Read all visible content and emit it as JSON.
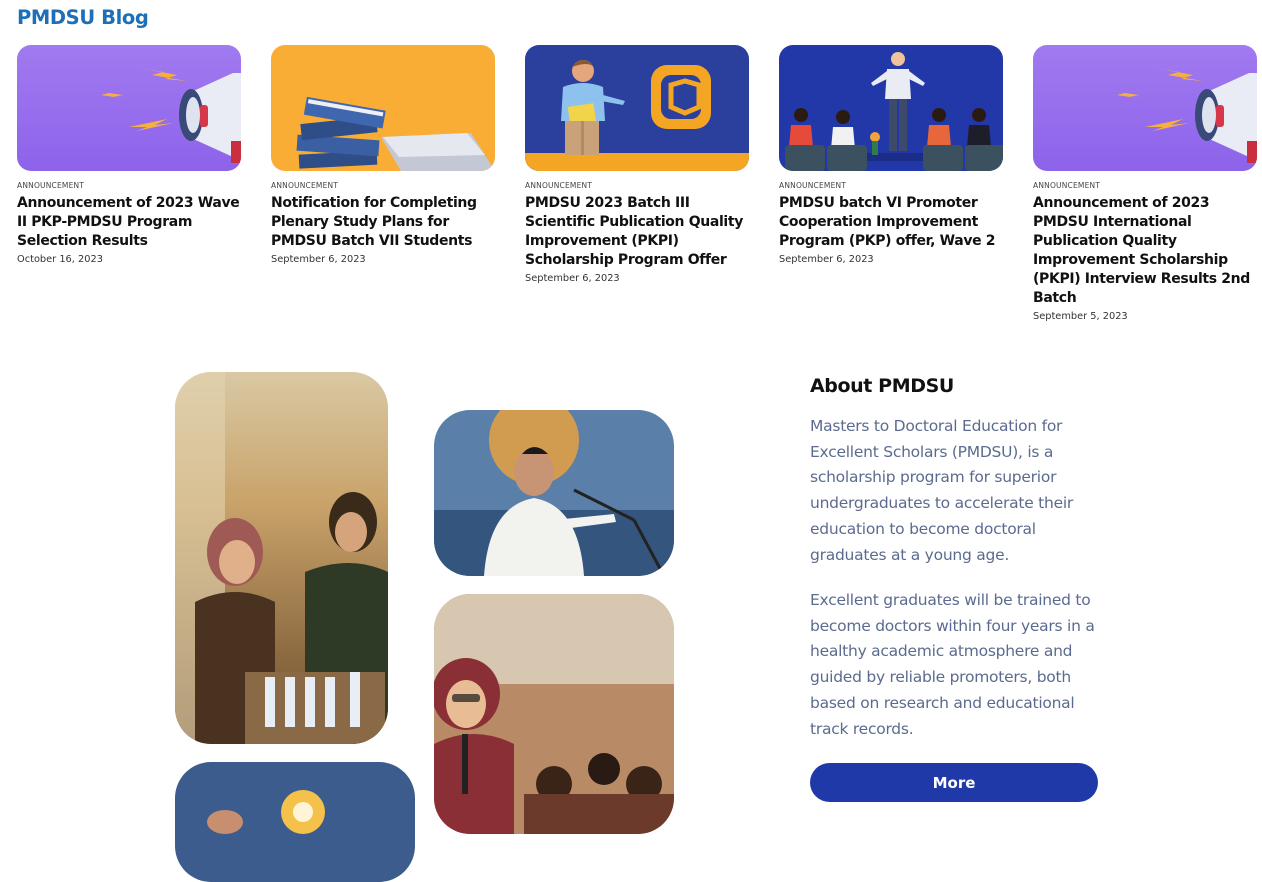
{
  "blog": {
    "title": "PMDSU Blog",
    "posts": [
      {
        "category": "ANNOUNCEMENT",
        "title": "Announcement of 2023 Wave II PKP-PMDSU Program Selection Results",
        "date": "October 16, 2023",
        "image": "megaphone-illustration"
      },
      {
        "category": "ANNOUNCEMENT",
        "title": "Notification for Completing Plenary Study Plans for PMDSU Batch VII Students",
        "date": "September 6, 2023",
        "image": "books-illustration"
      },
      {
        "category": "ANNOUNCEMENT",
        "title": "PMDSU 2023 Batch III Scientific Publication Quality Improvement (PKPI) Scholarship Program Offer",
        "date": "September 6, 2023",
        "image": "presenter-illustration"
      },
      {
        "category": "ANNOUNCEMENT",
        "title": "PMDSU batch VI Promoter Cooperation Improvement Program (PKP) offer, Wave 2",
        "date": "September 6, 2023",
        "image": "audience-illustration"
      },
      {
        "category": "ANNOUNCEMENT",
        "title": "Announcement of 2023 PMDSU International Publication Quality Improvement Scholarship (PKPI) Interview Results 2nd Batch",
        "date": "September 5, 2023",
        "image": "megaphone-illustration"
      }
    ]
  },
  "about": {
    "title": "About PMDSU",
    "paragraph1": "Masters to Doctoral Education for Excellent Scholars (PMDSU), is a scholarship program for superior undergraduates to accelerate their education to become doctoral graduates at a young age.",
    "paragraph2": "Excellent graduates will be trained to become doctors within four years in a healthy academic atmosphere and guided by reliable promoters, both based on research and educational track records.",
    "more_label": "More"
  },
  "colors": {
    "accent": "#1d6fb8",
    "button": "#1f3aa8",
    "body_text": "#5b6b8f"
  }
}
